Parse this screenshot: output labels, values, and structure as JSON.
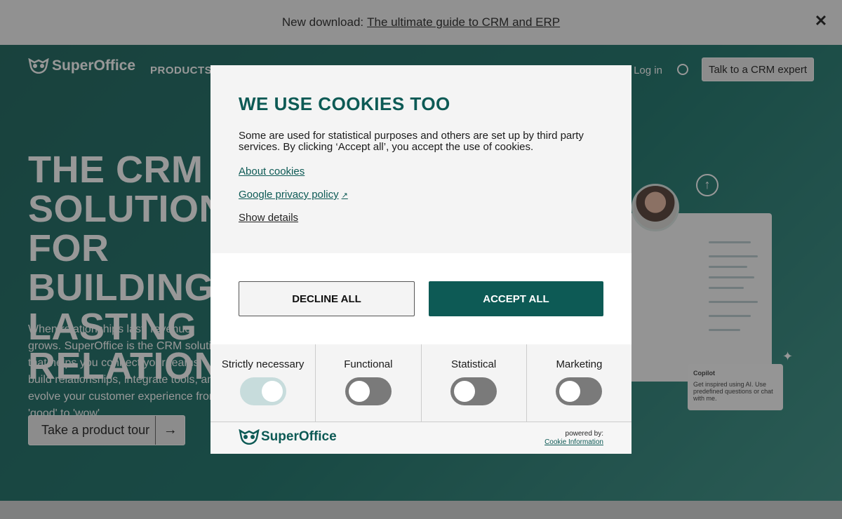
{
  "banner": {
    "prefix": "New download:",
    "link": "The ultimate guide to CRM and ERP",
    "close_icon": "close-icon"
  },
  "nav": {
    "logo_text": "SuperOffice",
    "products": "PRODUCTS",
    "login": "Log in",
    "cta": "Talk to a CRM expert"
  },
  "hero": {
    "title": "THE CRM SOLUTION FOR BUILDING LASTING RELATIONSHIPS",
    "description": "When relationships last, revenue grows. SuperOffice is the CRM solution that helps you connect your teams, build relationships, integrate tools, and evolve your customer experience from 'good' to 'wow'.",
    "tour_button": "Take a product tour",
    "copilot_title": "Copilot",
    "copilot_text": "Get inspired using AI. Use predefined questions or chat with me."
  },
  "modal": {
    "title": "WE USE COOKIES TOO",
    "text": "Some are used for statistical purposes and others are set up by third party services. By clicking ‘Accept all’, you accept the use of cookies.",
    "about_cookies": "About cookies",
    "google_policy": "Google privacy policy",
    "show_details": "Show details",
    "decline": "DECLINE ALL",
    "accept": "ACCEPT ALL",
    "toggles": [
      {
        "label": "Strictly necessary",
        "state": "on-disabled"
      },
      {
        "label": "Functional",
        "state": "off"
      },
      {
        "label": "Statistical",
        "state": "off"
      },
      {
        "label": "Marketing",
        "state": "off"
      }
    ],
    "footer_logo": "SuperOffice",
    "powered_by": "powered by:",
    "cookie_information": "Cookie Information"
  },
  "colors": {
    "brand_green": "#0d5a55",
    "toggle_on": "#c7dcdc",
    "toggle_off": "#7a7a7a"
  }
}
